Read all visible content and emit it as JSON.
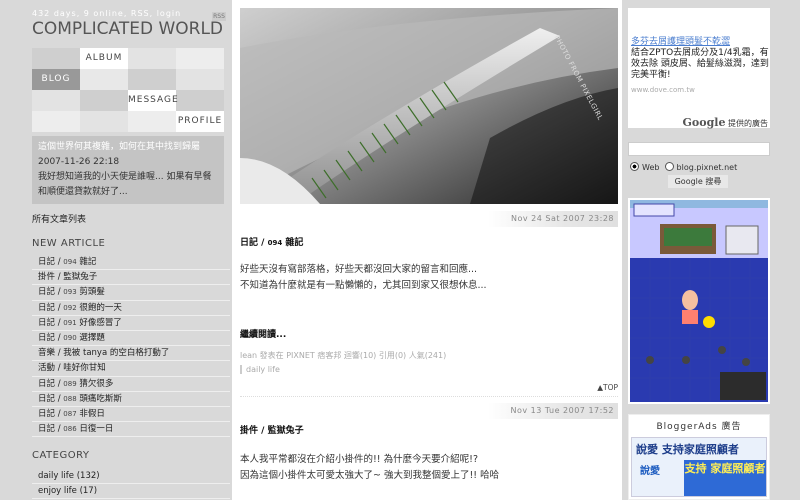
{
  "header": {
    "tagline": "432 days, 9 online, RSS, login",
    "site_title": "COMPLICATED WORLD",
    "rss_icon": "rss-icon"
  },
  "nav": {
    "album": "ALBUM",
    "blog": "BLOG",
    "message": "MESSAGE",
    "profile": "PROFILE"
  },
  "quote": {
    "line1": "這個世界何其複雜，如何在其中找到歸屬",
    "date": "2007-11-26 22:18",
    "text": "我好想知道我的小天使是誰喔... 如果有早餐和順便還貸款就好了..."
  },
  "sidebar": {
    "all_posts": "所有文章列表",
    "new_article_heading": "NEW ARTICLE",
    "articles": [
      {
        "cat": "日記",
        "num": "094",
        "title": "雜記"
      },
      {
        "cat": "掛件",
        "num": "",
        "title": "監獄兔子"
      },
      {
        "cat": "日記",
        "num": "093",
        "title": "剪頭髮"
      },
      {
        "cat": "日記",
        "num": "092",
        "title": "很飽的一天"
      },
      {
        "cat": "日記",
        "num": "091",
        "title": "好像感冒了"
      },
      {
        "cat": "日記",
        "num": "090",
        "title": "選擇題"
      },
      {
        "cat": "音樂",
        "num": "",
        "title": "我被 tanya 的空白格打動了"
      },
      {
        "cat": "活動",
        "num": "",
        "title": "哇好你甘知"
      },
      {
        "cat": "日記",
        "num": "089",
        "title": "猜欠很多"
      },
      {
        "cat": "日記",
        "num": "088",
        "title": "頭痛吃斯斯"
      },
      {
        "cat": "日記",
        "num": "087",
        "title": "非假日"
      },
      {
        "cat": "日記",
        "num": "086",
        "title": "日復一日"
      }
    ],
    "category_heading": "CATEGORY",
    "categories": [
      {
        "name": "daily life",
        "count": "(132)"
      },
      {
        "name": "enjoy life",
        "count": "(17)"
      }
    ]
  },
  "main": {
    "photo_credit": "PHOTO FROM PIXELGIRL",
    "posts": [
      {
        "date": "Nov 24 Sat 2007 23:28",
        "cat": "日記",
        "num": "094",
        "title": "雜記",
        "body": [
          "好些天沒有寫部落格，好些天都沒回大家的留言和回應...",
          "不知道為什麼就是有一點懶懶的，尤其回到家又很想休息..."
        ],
        "read_more": "繼續閱讀...",
        "meta": "lean 發表在 PIXNET 痞客邦 迴響(10) 引用(0) 人氣(241)",
        "tag": "daily life",
        "top": "TOP"
      },
      {
        "date": "Nov 13 Tue 2007 17:52",
        "cat": "掛件",
        "title": "監獄兔子",
        "body": [
          "本人我平常都沒在介紹小掛件的!! 為什麼今天要介紹呢!?",
          "因為這個小掛件太可愛太強大了~ 強大到我整個愛上了!! 哈哈"
        ]
      }
    ]
  },
  "right": {
    "ad_title": "多芬去屑護理頭髮不乾澀",
    "ad_text": "結合ZPTO去屑成分及1/4乳霜，有效去除 頭皮屑、給髮絲滋潤，達到完美平衡!",
    "ad_url": "www.dove.com.tw",
    "ad_google": "Google",
    "ad_provided": "提供的廣告",
    "search_placeholder": "",
    "radio_web": "Web",
    "radio_site": "blog.pixnet.net",
    "search_button": "Google 搜尋",
    "bloggerads_title": "BloggerAds 廣告",
    "bloggerads_head": "說愛 支持家庭照顧者",
    "bloggerads_sub": "說愛",
    "bloggerads_btn": "支持 家庭照顧者"
  },
  "colors": {
    "background": "#d9d9d9",
    "content": "#ffffff",
    "nav_active": "#999999",
    "ad_link": "#4a7dcf"
  }
}
